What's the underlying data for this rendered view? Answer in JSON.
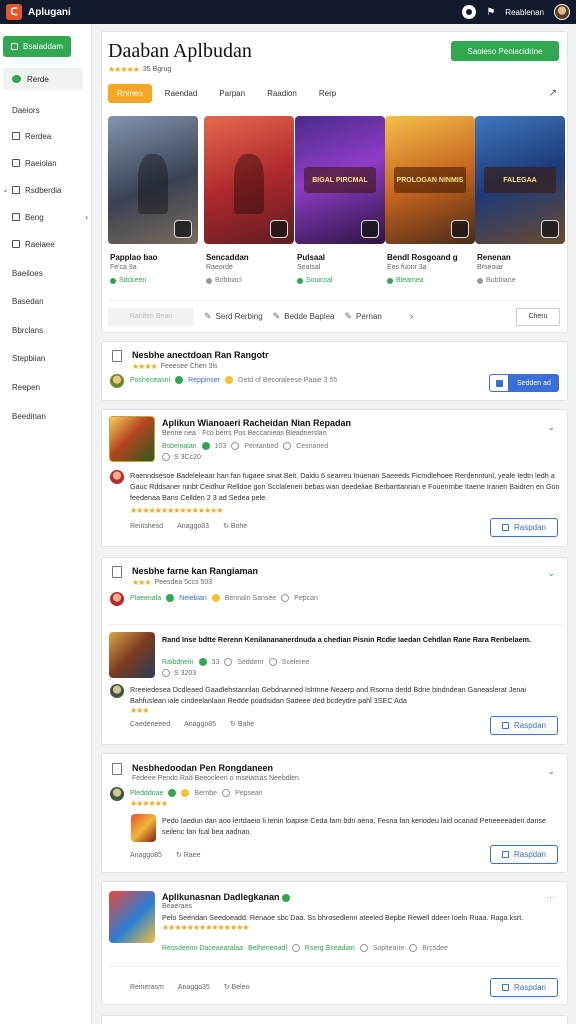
{
  "topbar": {
    "app_title": "Aplugani",
    "user_name": "Reablenan"
  },
  "sidebar": {
    "primary_button": "Bsaiaddam",
    "active_item": "Rerde",
    "items": [
      {
        "label": "Daeiors",
        "icon": "none"
      },
      {
        "label": "Rerdea",
        "icon": "square"
      },
      {
        "label": "Raeiolan",
        "icon": "square"
      },
      {
        "label": "Rsdberdia",
        "icon": "square",
        "caret": true
      },
      {
        "label": "Beng",
        "icon": "square",
        "chevron": true
      },
      {
        "label": "Raeiaee",
        "icon": "square"
      },
      {
        "label": "Baeiloes",
        "icon": "none"
      },
      {
        "label": "Basedan",
        "icon": "none"
      },
      {
        "label": "Bbrclans",
        "icon": "none"
      },
      {
        "label": "Stepbiian",
        "icon": "none"
      },
      {
        "label": "Reepen",
        "icon": "none"
      },
      {
        "label": "Beedinan",
        "icon": "none"
      }
    ]
  },
  "hero": {
    "title": "Daaban Aplbudan",
    "rating_text": "35 Bgrug",
    "action_button": "Saoleso Penlacidrine",
    "tabs": [
      "Rnmeo",
      "Raendad",
      "Parpan",
      "Raadion",
      "Rerp"
    ],
    "games": [
      {
        "name": "Papplao bao",
        "sub": "Fe'ca 9a",
        "meta": "Sdckeen",
        "meta_color": "green"
      },
      {
        "name": "Sencaddan",
        "sub": "Raeorde",
        "meta": "Bobbiacl",
        "meta_color": "gray"
      },
      {
        "name": "Pulsaal",
        "sub": "Seatsal",
        "meta": "Souiccal",
        "meta_color": "green"
      },
      {
        "name": "Bendl Rosgoand g",
        "sub": "Ees fuonr 3a",
        "meta": "Bleamea",
        "meta_color": "green"
      },
      {
        "name": "Renenan",
        "sub": "Brseoiar",
        "meta": "Bubbiane",
        "meta_color": "gray"
      }
    ],
    "tile_labels": [
      "",
      "",
      "BIGAL PIRCMAL",
      "PROLOGAN NINMIS",
      "FALEGAA"
    ],
    "footer": {
      "ghost_button": "Ranifen Bean",
      "link1": "Serd Rerbing",
      "link2": "Bedde Baplea",
      "link3": "Pernan",
      "outline_button": "Cheru"
    }
  },
  "posts": [
    {
      "title": "Nesbhe anectdoan Ran Rangotr",
      "sub": "Feeesee Chen 3ls",
      "author": "Posheceasnl",
      "author2": "Reppinser",
      "meta": "Getd of Becoraleese Paaie 3 55",
      "split_left": "",
      "split_right": "Sedden ad"
    },
    {
      "title": "Aplikun Wianoaeri Racheidan Nian Repadan",
      "sub": "Benne nea · Fco berrs Pos Beccanieas Bleadnerslan",
      "author": "Bsbeinalan",
      "meta1": "103",
      "meta2": "Pentanbed",
      "meta3": "Cesnaned",
      "submeta": "S 3Cc20",
      "body": "Raenndsesoe Badeleleaar han fan fugaee sinat Beit. Daidu 6 searreu Inuenan Saeeeds Ficmdlehoee Rerdenntunl, yeale Iedtn ledh a Gauc Rddsaner ninbt Ceidhur Relldoe gon Scclalenen bebas wan deedeliae Berbarttannan e Fouenrnbe Itaene Iranen Baidren en Gon feedenaa Bans Cellden 2 3 ad Sedea pele.",
      "action1": "Reinshesd",
      "action2": "Anaggo83",
      "action3": "Bohe",
      "button": "Raspdan"
    },
    {
      "title": "Nesbhe farne kan Rangiaman",
      "sub": "Peesdea 5ccs 503",
      "author": "Plaeenala",
      "author2": "Neiebian",
      "meta": "Bennaln Sansee",
      "meta2": "Pepcan"
    },
    {
      "title": "Rand Inse bdtte Rerenn Kenilanananerdnuda a chedian Pisnin Rcdie Iaedan Cehdlan Rane Rara Renbelaem.",
      "author": "Raibdneln",
      "meta1": "33",
      "meta2": "Seddenr",
      "meta3": "Sceleree",
      "submeta": "S 3203",
      "body": "Rreeiedesea Dcdleaed Gaadlehstannlan Gebdnanned Ishtnne Neaerp and Rsorna dedd Bdrie bindndean Ganeaslerat Jenai Bahfuslean iale cindeelanlaan Redde poadsidan Sadeee ded bcdeydre pahl 3SEC Ada",
      "action1": "Caedeneeed",
      "action2": "Anaggo85",
      "action3": "Bahe",
      "button": "Raspdan"
    },
    {
      "title": "Nesbhedoodan Pen Rongdaneen",
      "sub": "Fedeee Pendo Rad Beeocleen o mseiatsas Neebdlen",
      "author": "Pledddoae",
      "meta": "Bernbe",
      "meta2": "Pepsean",
      "body": "Pedo Iaedun dan aoo lertdaeio Ii tenin loapise Ceda fam bdn aena, Fesna fan kenodeu laid ocanad Peneeeeaden danse seilenc fan fcal bea aadnan.",
      "action2": "Anaggo85",
      "action3": "Raee",
      "button": "Raspdan"
    },
    {
      "title": "Aplikunasnan Dadlegkanan",
      "sub": "Beaeraes",
      "body": "Pelo Seendan Seedoeadd. Renaoe sbc Daa. Ss bhrosedlenn ateeled Bepbe Rewell ddeer Ioeln Ruaa. Raga ksrt.",
      "meta1": "Ressdeenn Daceaearalaa",
      "meta2": "Belheneoadl",
      "meta3": "Rserg Sseadian",
      "meta4": "Sopltearie",
      "meta5": "Brcsdee",
      "action1": "Reinerasm",
      "action2": "Anaggo35",
      "action3": "Beleo",
      "button": "Raspdan"
    }
  ],
  "colors": {
    "accent_green": "#2fa84f",
    "accent_blue": "#3b6fd8",
    "tab_orange": "#f6a623",
    "topbar": "#101a2c"
  }
}
